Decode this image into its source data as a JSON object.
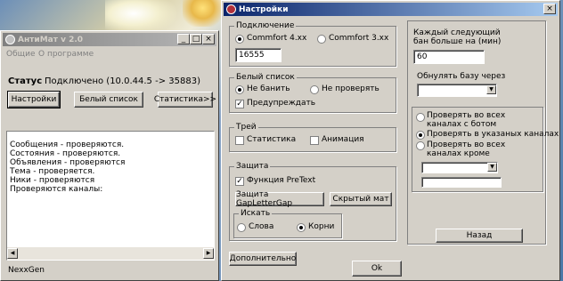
{
  "left_window": {
    "title": "АнтиМат v 2.0",
    "menu": [
      "Общие",
      "О программе"
    ],
    "status_label": "Статус",
    "status_value": "Подключено (10.0.44.5 -> 35883)",
    "buttons": {
      "settings": "Настройки",
      "whitelist": "Белый список",
      "stats": "Статистика>>"
    },
    "log_lines": [
      "Сообщения - проверяются.",
      "Состояния - проверяются.",
      "Объявления - проверяются",
      "Тема - проверяется.",
      "Ники - проверяются",
      "Проверяются каналы:"
    ],
    "footer": "NexxGen"
  },
  "settings_window": {
    "title": "Настройки",
    "connection": {
      "title": "Подключение",
      "options": [
        "Commfort 4.xx",
        "Commfort 3.xx"
      ],
      "selected": 0,
      "port": "16555"
    },
    "whitelist": {
      "title": "Белый список",
      "options": [
        "Не банить",
        "Не проверять"
      ],
      "selected": 0,
      "warn_label": "Предупреждать",
      "warn_checked": true
    },
    "tray": {
      "title": "Трей",
      "stats_label": "Статистика",
      "stats_checked": false,
      "anim_label": "Анимация",
      "anim_checked": false
    },
    "protection": {
      "title": "Защита",
      "pretext_label": "Функция PreText",
      "pretext_checked": true,
      "gap_button": "Защита GapLetterGap",
      "hidden_button": "Скрытый мат",
      "search_title": "Искать",
      "search_options": [
        "Слова",
        "Корни"
      ],
      "search_selected": 1
    },
    "extra_button": "Дополнительно",
    "ok_button": "Ok",
    "ban_label": "Каждый следующий бан больше на (мин)",
    "ban_value": "60",
    "reset_label": "Обнулять базу  через",
    "reset_value": "",
    "channels": {
      "options": [
        "Проверять во всех каналах с ботом",
        "Проверять в указаных каналах",
        "Проверять во всех каналах кроме"
      ],
      "selected": 1,
      "select_value": "",
      "text_value": ""
    },
    "back_button": "Назад"
  }
}
